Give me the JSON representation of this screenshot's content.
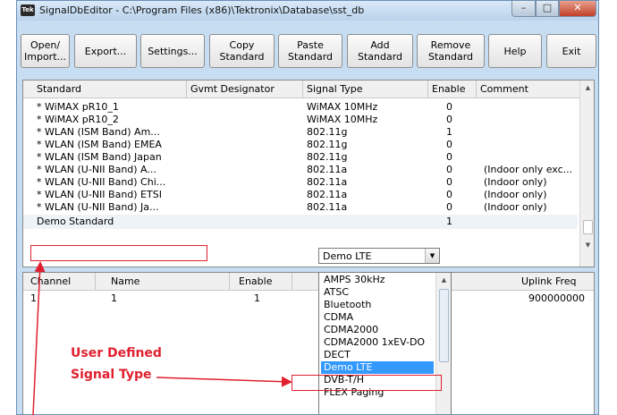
{
  "window": {
    "title": "SignalDbEditor - C:\\Program Files (x86)\\Tektronix\\Database\\sst_db",
    "app_icon": "Tek",
    "close_glyph": "✕",
    "minimize_glyph": "–",
    "maximize_glyph": "□"
  },
  "toolbar": {
    "buttons": [
      {
        "label": "Open/\nImport..."
      },
      {
        "label": "Export..."
      },
      {
        "label": "Settings..."
      },
      {
        "label": "Copy\nStandard"
      },
      {
        "label": "Paste\nStandard"
      },
      {
        "label": "Add\nStandard"
      },
      {
        "label": "Remove\nStandard"
      },
      {
        "label": "Help"
      },
      {
        "label": "Exit"
      }
    ]
  },
  "standards_table": {
    "headers": {
      "standard": "Standard",
      "gvmt": "Gvmt Designator",
      "signal_type": "Signal Type",
      "enable": "Enable",
      "comment": "Comment"
    },
    "rows": [
      {
        "standard": "* WiMAX pR10_1",
        "gvmt": "",
        "signal_type": "WiMAX 10MHz",
        "enable": "0",
        "comment": ""
      },
      {
        "standard": "* WiMAX pR10_2",
        "gvmt": "",
        "signal_type": "WiMAX 10MHz",
        "enable": "0",
        "comment": ""
      },
      {
        "standard": "* WLAN (ISM Band) Am...",
        "gvmt": "",
        "signal_type": "802.11g",
        "enable": "1",
        "comment": ""
      },
      {
        "standard": "* WLAN (ISM Band) EMEA",
        "gvmt": "",
        "signal_type": "802.11g",
        "enable": "0",
        "comment": ""
      },
      {
        "standard": "* WLAN (ISM Band) Japan",
        "gvmt": "",
        "signal_type": "802.11g",
        "enable": "0",
        "comment": ""
      },
      {
        "standard": "* WLAN (U-NII Band) A...",
        "gvmt": "",
        "signal_type": "802.11a",
        "enable": "0",
        "comment": "(Indoor only exc..."
      },
      {
        "standard": "* WLAN (U-NII Band) Chi...",
        "gvmt": "",
        "signal_type": "802.11a",
        "enable": "0",
        "comment": "(Indoor only)"
      },
      {
        "standard": "* WLAN (U-NII Band) ETSI",
        "gvmt": "",
        "signal_type": "802.11a",
        "enable": "0",
        "comment": "(Indoor only)"
      },
      {
        "standard": "* WLAN (U-NII Band) Ja...",
        "gvmt": "",
        "signal_type": "802.11a",
        "enable": "0",
        "comment": "(Indoor only)"
      }
    ],
    "edit_row": {
      "standard": "Demo Standard",
      "signal_type": "Demo LTE",
      "enable": "1"
    },
    "scroll_up_icon": "▲",
    "scroll_down_icon": "▼"
  },
  "channel_table": {
    "headers": {
      "channel": "Channel",
      "name": "Name",
      "enable": "Enable",
      "uplink_freq": "Uplink Freq"
    },
    "rows": [
      {
        "channel": "1",
        "name": "1",
        "enable": "1",
        "uplink_freq": "900000000"
      }
    ]
  },
  "signal_type_dropdown": {
    "options": [
      "AMPS 30kHz",
      "ATSC",
      "Bluetooth",
      "CDMA",
      "CDMA2000",
      "CDMA2000 1xEV-DO",
      "DECT",
      "Demo LTE",
      "DVB-T/H",
      "FLEX Paging"
    ],
    "selected": "Demo LTE",
    "arrow_icon": "▼"
  },
  "annotation": {
    "line1": "User Defined",
    "line2": "Signal Type",
    "color": "#e0202e"
  }
}
